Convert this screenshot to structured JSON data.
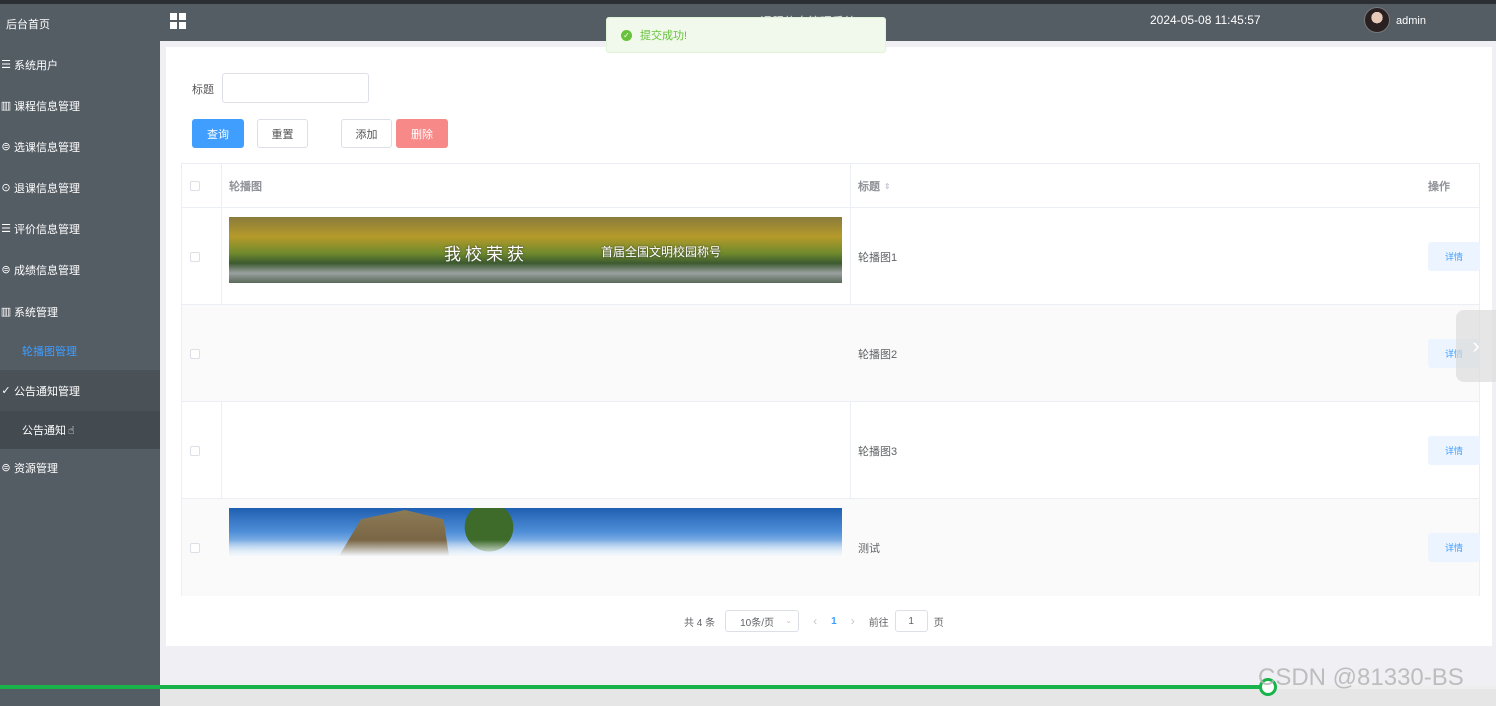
{
  "sidebar": {
    "home": "后台首页",
    "items": [
      {
        "label": "系统用户",
        "icon": "list-icon"
      },
      {
        "label": "课程信息管理",
        "icon": "bar-chart-icon"
      },
      {
        "label": "选课信息管理",
        "icon": "circle-equal-icon"
      },
      {
        "label": "退课信息管理",
        "icon": "circle-back-icon"
      },
      {
        "label": "评价信息管理",
        "icon": "list-icon"
      },
      {
        "label": "成绩信息管理",
        "icon": "circle-equal-icon"
      },
      {
        "label": "系统管理",
        "icon": "bar-chart-icon"
      },
      {
        "label": "公告通知管理",
        "icon": "circle-check-icon"
      },
      {
        "label": "资源管理",
        "icon": "circle-equal-icon"
      }
    ],
    "sub_carousel": "轮播图管理",
    "sub_notice": "公告通知"
  },
  "header": {
    "system_title": "课程信息管理系统",
    "datetime": "2024-05-08 11:45:57",
    "user": "admin"
  },
  "toast": {
    "message": "提交成功!",
    "color": "#67c23a"
  },
  "search": {
    "label": "标题",
    "value": ""
  },
  "buttons": {
    "query": "查询",
    "reset": "重置",
    "add": "添加",
    "delete": "删除"
  },
  "table": {
    "headers": {
      "image": "轮播图",
      "title": "标题",
      "action": "操作"
    },
    "rows": [
      {
        "title": "轮播图1",
        "action": "详情",
        "banner_text": "我校荣获",
        "banner_text2": "首届全国文明校园称号"
      },
      {
        "title": "轮播图2",
        "action": "详情"
      },
      {
        "title": "轮播图3",
        "action": "详情"
      },
      {
        "title": "测试",
        "action": "详情"
      }
    ]
  },
  "pagination": {
    "total": "共 4 条",
    "page_size": "10条/页",
    "current": "1",
    "goto_label": "前往",
    "goto_value": "1",
    "page_unit": "页"
  },
  "watermark": "CSDN @81330-BS",
  "colors": {
    "primary": "#409eff",
    "danger": "#f78989",
    "sidebar": "#545c64",
    "progress": "#18b34a"
  }
}
